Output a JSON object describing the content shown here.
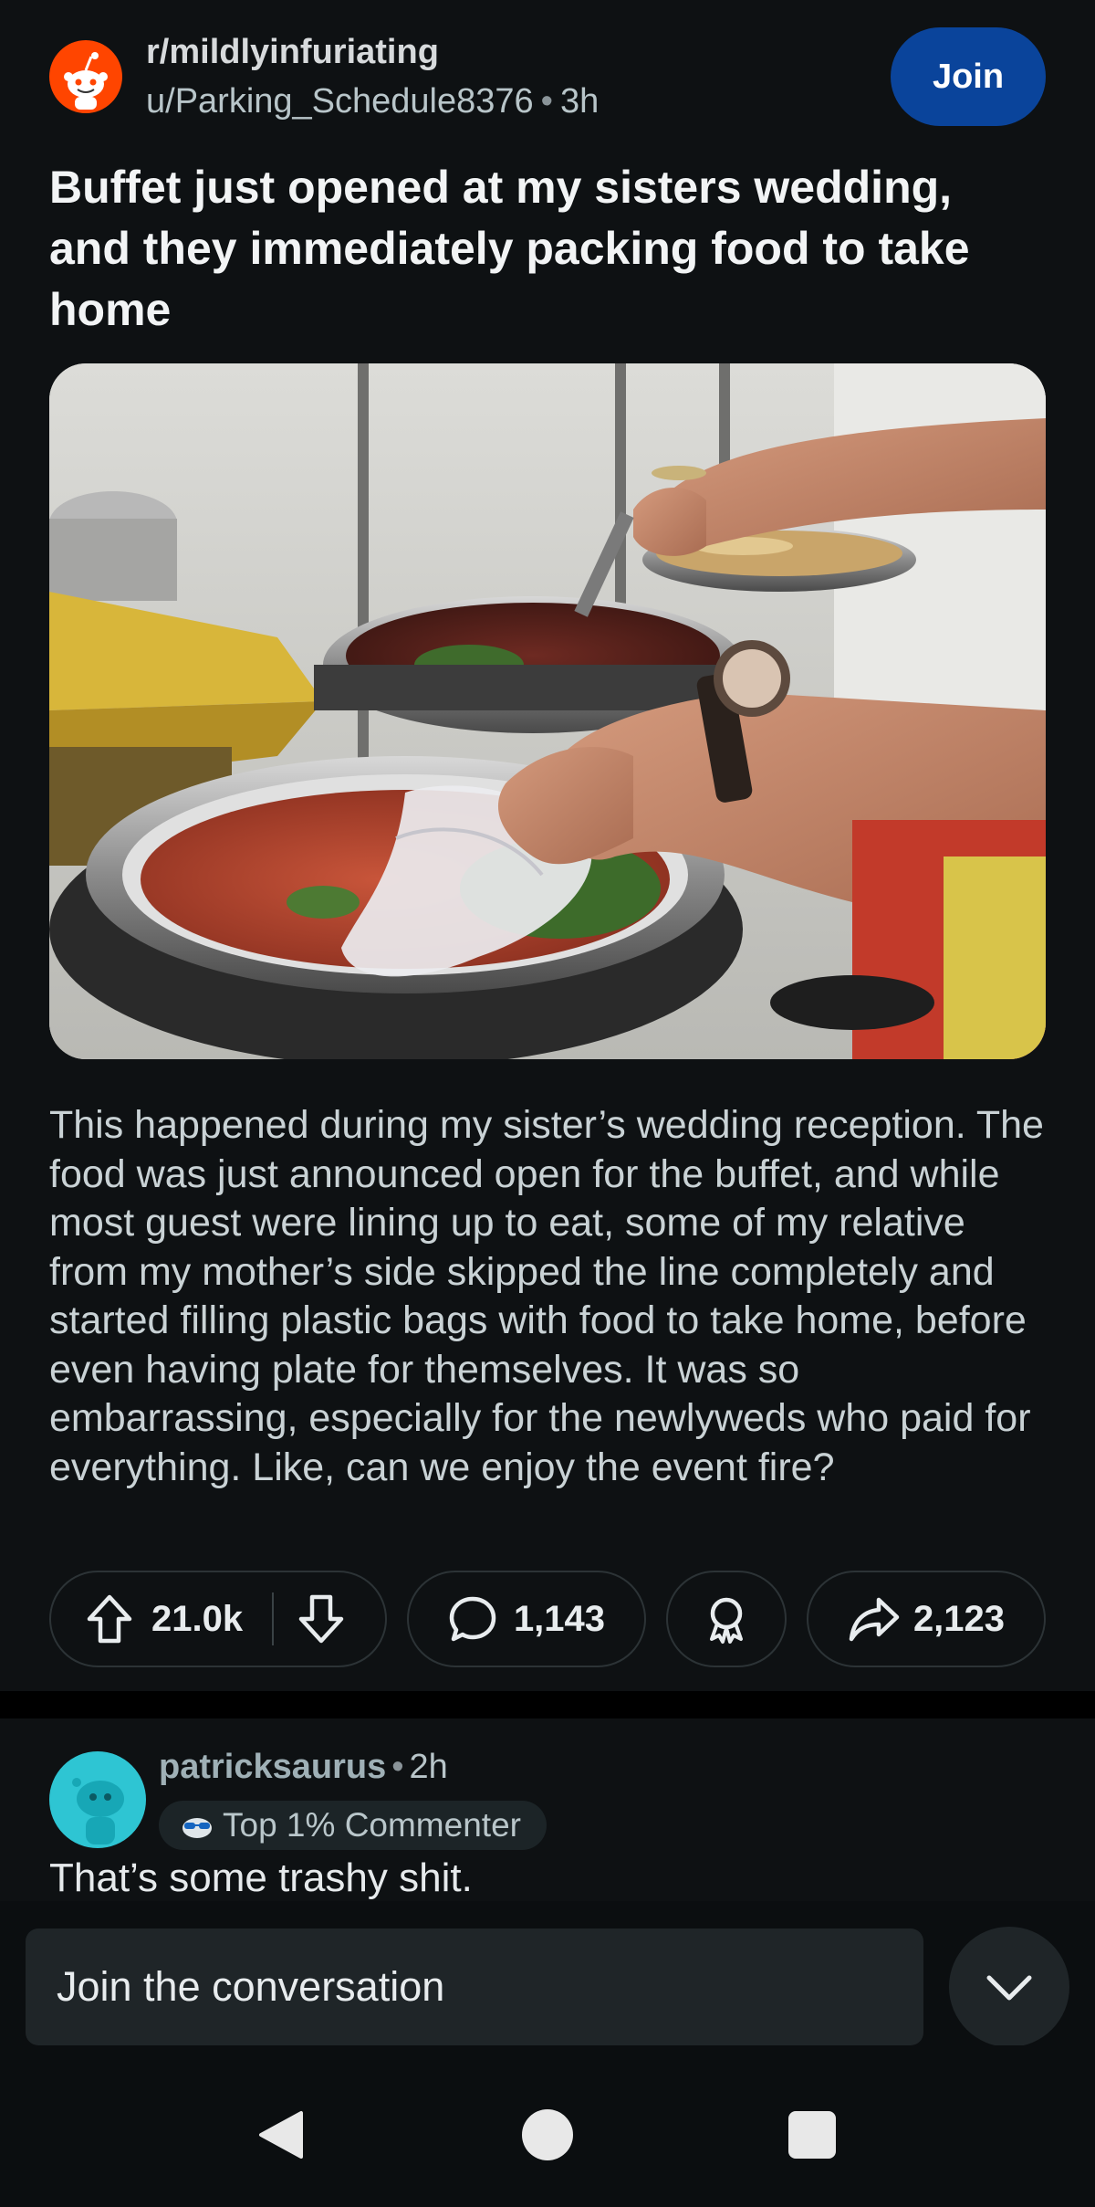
{
  "post": {
    "subreddit": "r/mildlyinfuriating",
    "author": "u/Parking_Schedule8376",
    "time": "3h",
    "join_label": "Join",
    "title": "Buffet just opened at my sisters wedding, and they immediately packing food to take home",
    "body": "This happened during my sister’s wedding reception. The food was just announced open for the buffet, and while most guest were lining up to eat, some of my relative from my mother’s side skipped the line completely and started filling plastic bags with food to take home, before even having plate for themselves. It was so embarrassing, especially for the newlyweds who paid for everything. Like, can we enjoy the event fire?",
    "image_description": "Buffet chafing dishes with food being scooped into a plastic bag"
  },
  "actions": {
    "upvotes": "21.0k",
    "comments": "1,143",
    "shares": "2,123"
  },
  "comment": {
    "author": "patricksaurus",
    "time": "2h",
    "flair": "Top 1% Commenter",
    "text": "That’s some trashy shit."
  },
  "composer": {
    "placeholder": "Join the conversation"
  },
  "colors": {
    "background": "#0e1113",
    "join_button": "#0a449b",
    "subreddit_avatar": "#ff4500",
    "comment_avatar": "#2ec5d3"
  }
}
